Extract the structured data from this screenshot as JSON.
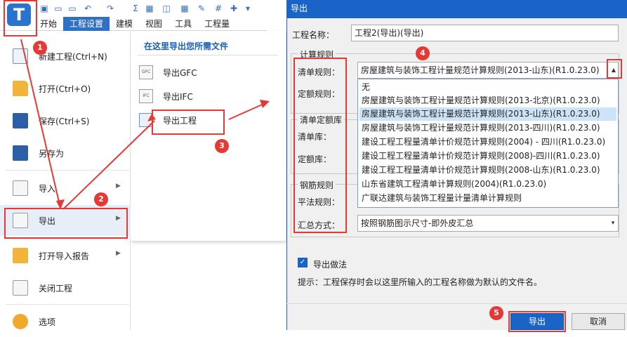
{
  "app": {
    "logo_letter": "T",
    "tabs": [
      "开始",
      "工程设置",
      "建模",
      "视图",
      "工具",
      "工程量"
    ]
  },
  "file_menu": {
    "items": [
      {
        "label": "新建工程(Ctrl+N)",
        "icon": "new-doc-icon"
      },
      {
        "label": "打开(Ctrl+O)",
        "icon": "folder-open-icon"
      },
      {
        "label": "保存(Ctrl+S)",
        "icon": "save-icon"
      },
      {
        "label": "另存为",
        "icon": "save-as-icon"
      },
      {
        "label": "导入",
        "icon": "import-icon"
      },
      {
        "label": "导出",
        "icon": "export-icon"
      },
      {
        "label": "打开导入报告",
        "icon": "folder-report-icon"
      },
      {
        "label": "关闭工程",
        "icon": "close-doc-icon"
      },
      {
        "label": "选项",
        "icon": "gear-icon"
      }
    ]
  },
  "export_submenu": {
    "title": "在这里导出您所需文件",
    "items": [
      {
        "label": "导出GFC",
        "icon_text": "GFC"
      },
      {
        "label": "导出IFC",
        "icon_text": "IFC"
      },
      {
        "label": "导出工程",
        "icon_text": ""
      }
    ]
  },
  "dialog": {
    "title": "导出",
    "project_name_label": "工程名称：",
    "project_name_value": "工程2(导出)(导出)",
    "calc_rules_group": "计算规则",
    "list_rule_label": "清单规则：",
    "list_rule_value": "房屋建筑与装饰工程计量规范计算规则(2013-山东)(R1.0.23.0)",
    "quota_rule_label": "定额规则：",
    "quota_lib_group": "清单定额库",
    "list_lib_label": "清单库：",
    "quota_lib_label": "定额库：",
    "rebar_group": "钢筋规则",
    "flat_rule_label": "平法规则：",
    "summary_label": "汇总方式：",
    "summary_value": "按照钢筋图示尺寸-即外皮汇总",
    "dropdown_options": [
      "无",
      "房屋建筑与装饰工程计量规范计算规则(2013-北京)(R1.0.23.0)",
      "房屋建筑与装饰工程计量规范计算规则(2013-山东)(R1.0.23.0)",
      "房屋建筑与装饰工程计量规范计算规则(2013-四川)(R1.0.23.0)",
      "建设工程工程量清单计价规范计算规则(2004) - 四川(R1.0.23.0)",
      "建设工程工程量清单计价规范计算规则(2008)-四川(R1.0.23.0)",
      "建设工程工程量清单计价规范计算规则(2008-山东)(R1.0.23.0)",
      "山东省建筑工程清单计算规则(2004)(R1.0.23.0)",
      "广联达建筑与装饰工程量计量清单计算规则"
    ],
    "selected_option_index": 2,
    "export_method_label": "导出做法",
    "export_method_checked": true,
    "hint": "提示：工程保存时会以这里所输入的工程名称做为默认的文件名。",
    "ok_button": "导出",
    "cancel_button": "取消"
  },
  "annotations": {
    "badges": [
      "1",
      "2",
      "3",
      "4",
      "5"
    ],
    "highlight_color": "#e53935"
  },
  "colors": {
    "accent": "#1a63c7",
    "tab_active": "#2f6fc4",
    "selected_row": "#cde3f7"
  }
}
